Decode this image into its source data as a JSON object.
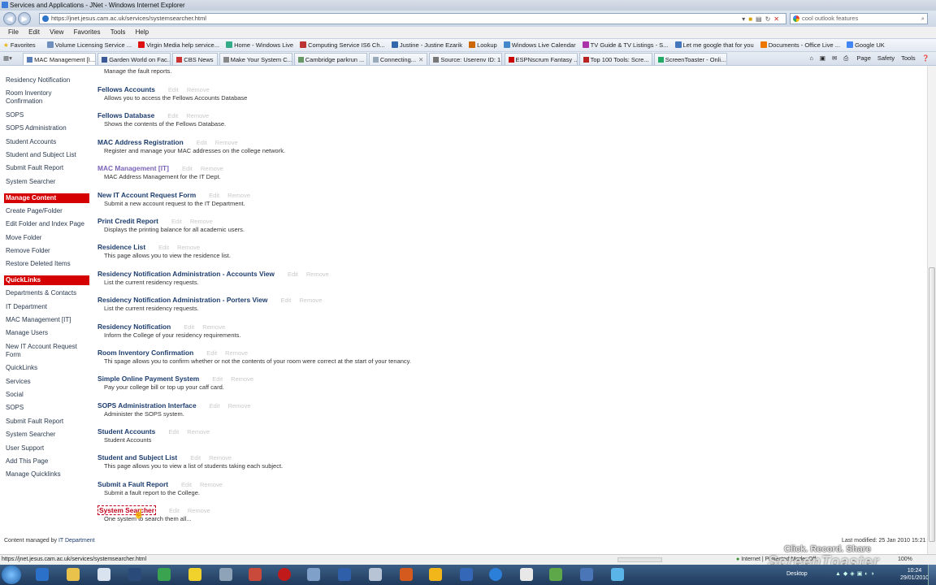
{
  "window": {
    "title": "Services and Applications - JNet - Windows Internet Explorer"
  },
  "address": {
    "url": "https://jnet.jesus.cam.ac.uk/services/systemsearcher.html",
    "search": "cool outlook features"
  },
  "menu": [
    "File",
    "Edit",
    "View",
    "Favorites",
    "Tools",
    "Help"
  ],
  "favorites": {
    "label": "Favorites",
    "items": [
      "Volume Licensing Service ...",
      "Virgin Media  help  service...",
      "Home - Windows Live",
      "Computing Service IS6 Ch...",
      "Justine - Justine Ezarik",
      "Lookup",
      "Windows Live Calendar",
      "TV Guide & TV Listings - S...",
      "Let me google that for you",
      "Documents - Office Live ...",
      "Google UK"
    ]
  },
  "tabs": [
    "MAC Management [I...",
    "Garden World on Fac...",
    "CBS News",
    "Make Your System C...",
    "Cambridge parkrun ...",
    "Connecting...",
    "Source: Userenv ID: 1...",
    "ESPNscrum Fantasy ...",
    "Top 100 Tools: Scre...",
    "ScreenToaster - Onli..."
  ],
  "command_bar": [
    "Page",
    "Safety",
    "Tools"
  ],
  "sidebar": {
    "top_items": [
      "Residency Notification",
      "Room Inventory Confirmation",
      "SOPS",
      "SOPS Administration",
      "Student Accounts",
      "Student and Subject List",
      "Submit Fault Report",
      "System Searcher"
    ],
    "manage_header": "Manage Content",
    "manage_items": [
      "Create Page/Folder",
      "Edit Folder and Index Page",
      "Move Folder",
      "Remove Folder",
      "Restore Deleted Items"
    ],
    "quicklinks_header": "QuickLinks",
    "quick_items": [
      "Departments & Contacts",
      "IT Department",
      "MAC Management [IT]",
      "Manage Users",
      "New IT Account Request Form",
      "QuickLinks",
      "Services",
      "Social",
      "SOPS",
      "Submit Fault Report",
      "System Searcher",
      "User Support",
      "Add This Page",
      "Manage Quicklinks"
    ]
  },
  "main": {
    "first_desc": "Manage the fault reports.",
    "edit_label": "Edit",
    "remove_label": "Remove",
    "entries": [
      {
        "title": "Fellows Accounts",
        "desc": "Allows you to access the Fellows Accounts Database"
      },
      {
        "title": "Fellows Database",
        "desc": "Shows the contents of the Fellows Database."
      },
      {
        "title": "MAC Address Registration",
        "desc": "Register and manage your MAC addresses on the college network."
      },
      {
        "title": "MAC Management [IT]",
        "desc": "MAC Address Management for the IT Dept."
      },
      {
        "title": "New IT Account Request Form",
        "desc": "Submit a new account request to the IT Department."
      },
      {
        "title": "Print Credit Report",
        "desc": "Displays the printing balance for all academic users."
      },
      {
        "title": "Residence List",
        "desc": "This page allows you to view the residence list."
      },
      {
        "title": "Residency Notification Administration - Accounts View",
        "desc": "List the current residency requests."
      },
      {
        "title": "Residency Notification Administration - Porters View",
        "desc": "List the current residency requests."
      },
      {
        "title": "Residency Notification",
        "desc": "Inform the College of your residency requirements."
      },
      {
        "title": "Room Inventory Confirmation",
        "desc": "Thi spage allows you to confirm whether or not the contents of your room were correct at the start of your tenancy."
      },
      {
        "title": "Simple Online Payment System",
        "desc": "Pay your college bill or top up your caff card."
      },
      {
        "title": "SOPS Administration Interface",
        "desc": "Administer the SOPS system."
      },
      {
        "title": "Student Accounts",
        "desc": "Student Accounts"
      },
      {
        "title": "Student and Subject List",
        "desc": "This page allows you to view a list of students taking each subject."
      },
      {
        "title": "Submit a Fault Report",
        "desc": "Submit a fault report to the College."
      },
      {
        "title": "System Searcher",
        "desc": "One system to search them all..."
      }
    ]
  },
  "footer": {
    "managed_prefix": "Content managed by",
    "managed_link": "IT Department",
    "modified": "Last modified: 25 Jan 2010 15:21"
  },
  "status": {
    "url": "https://jnet.jesus.cam.ac.uk/services/systemsearcher.html",
    "zone": "Internet | Protected Mode: Off",
    "zoom": "100%"
  },
  "watermark": {
    "line1": "Click. Record. Share",
    "brand": "ScreenToaster"
  },
  "taskbar": {
    "desktop": "Desktop",
    "time": "10:24",
    "date": "29/01/2010"
  }
}
